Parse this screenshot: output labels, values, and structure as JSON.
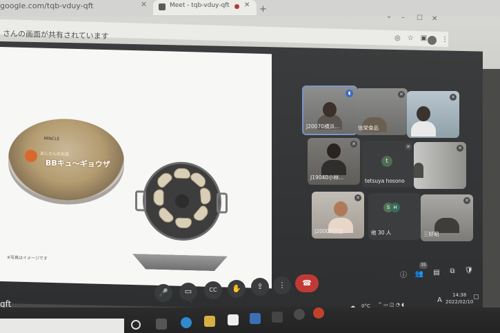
{
  "browser": {
    "tab_url_fragment": "google.com/tqb-vduy-qft",
    "tab_close": "✕",
    "active_tab_title": "Meet - tqb-vduy-qft",
    "active_tab_close": "✕",
    "new_tab": "+",
    "window_controls": [
      "⌄",
      "–",
      "☐",
      "✕"
    ],
    "kebab": "⋮"
  },
  "banner": {
    "text": "さんの画面が共有されています"
  },
  "slide": {
    "tray_brand": "MINCLE",
    "tray_subtitle": "あじさんのお店",
    "tray_title": "BBキュ〜ギョウザ",
    "note": "※写真はイメージです",
    "cursor": "↖"
  },
  "participants": [
    {
      "name": "J20070横浜...",
      "state": "speaking"
    },
    {
      "name": "信栄食品",
      "state": "muted"
    },
    {
      "name": "",
      "state": "muted"
    },
    {
      "name": "J19040小林...",
      "state": "muted"
    },
    {
      "name": "tetsuya hosono",
      "state": "muted",
      "avatar_letter": "t"
    },
    {
      "name": "",
      "state": "muted"
    },
    {
      "name": "J20005日出...",
      "state": "muted"
    },
    {
      "name": "他 30 人",
      "state": "others",
      "avatar_letters": [
        "S",
        "H"
      ]
    },
    {
      "name": "三好昭",
      "state": "muted"
    }
  ],
  "controls": {
    "mic": "🎤",
    "camera": "▭",
    "captions": "CC",
    "raise_hand": "✋",
    "present": "⇪",
    "more": "⋮",
    "end_call": "☎",
    "info": "ⓘ",
    "people": "👥",
    "people_count": "35",
    "chat": "▤",
    "activities": "⧉",
    "host_controls": "🛡"
  },
  "meeting_code_fragment": "qft",
  "taskbar": {
    "weather": "0°C",
    "ime": "A",
    "time": "14:38",
    "date": "2022/02/10"
  }
}
